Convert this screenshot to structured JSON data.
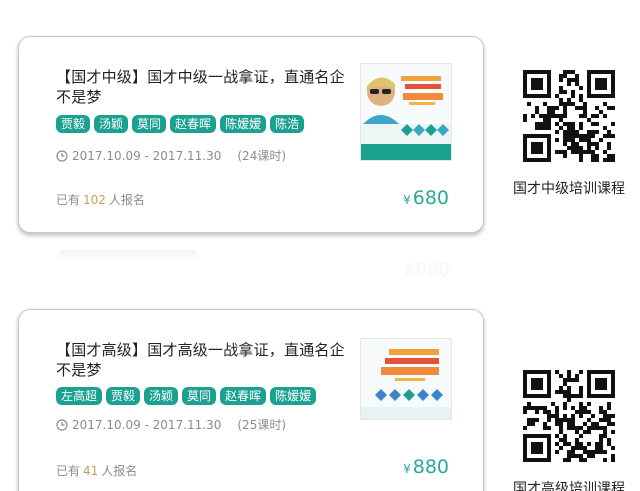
{
  "courses": [
    {
      "title": "【国才中级】国才中级一战拿证，直通名企不是梦",
      "instructors": [
        "贾毅",
        "汤颖",
        "莫同",
        "赵春晖",
        "陈嫒嫒",
        "陈浩"
      ],
      "date_range": "2017.10.09 - 2017.11.30",
      "hours": "(24课时)",
      "enroll_prefix": "已有",
      "enroll_count": "102",
      "enroll_suffix": "人报名",
      "currency": "¥",
      "price": "680",
      "qr_label": "国才中级培训课程",
      "thumbnail_icon": "course-poster-thumbnail"
    },
    {
      "title": "【国才高级】国才高级一战拿证，直通名企不是梦",
      "instructors": [
        "左高超",
        "贾毅",
        "汤颖",
        "莫同",
        "赵春晖",
        "陈嫒嫒"
      ],
      "date_range": "2017.10.09 - 2017.11.30",
      "hours": "(25课时)",
      "enroll_prefix": "已有",
      "enroll_count": "41",
      "enroll_suffix": "人报名",
      "currency": "¥",
      "price": "880",
      "qr_label": "国才高级培训课程",
      "thumbnail_icon": "course-poster-thumbnail"
    }
  ],
  "colors": {
    "tag_bg": "#1aa18f",
    "price": "#2aa99b",
    "enroll_count": "#c6a15b",
    "meta_text": "#8c8c8c"
  }
}
